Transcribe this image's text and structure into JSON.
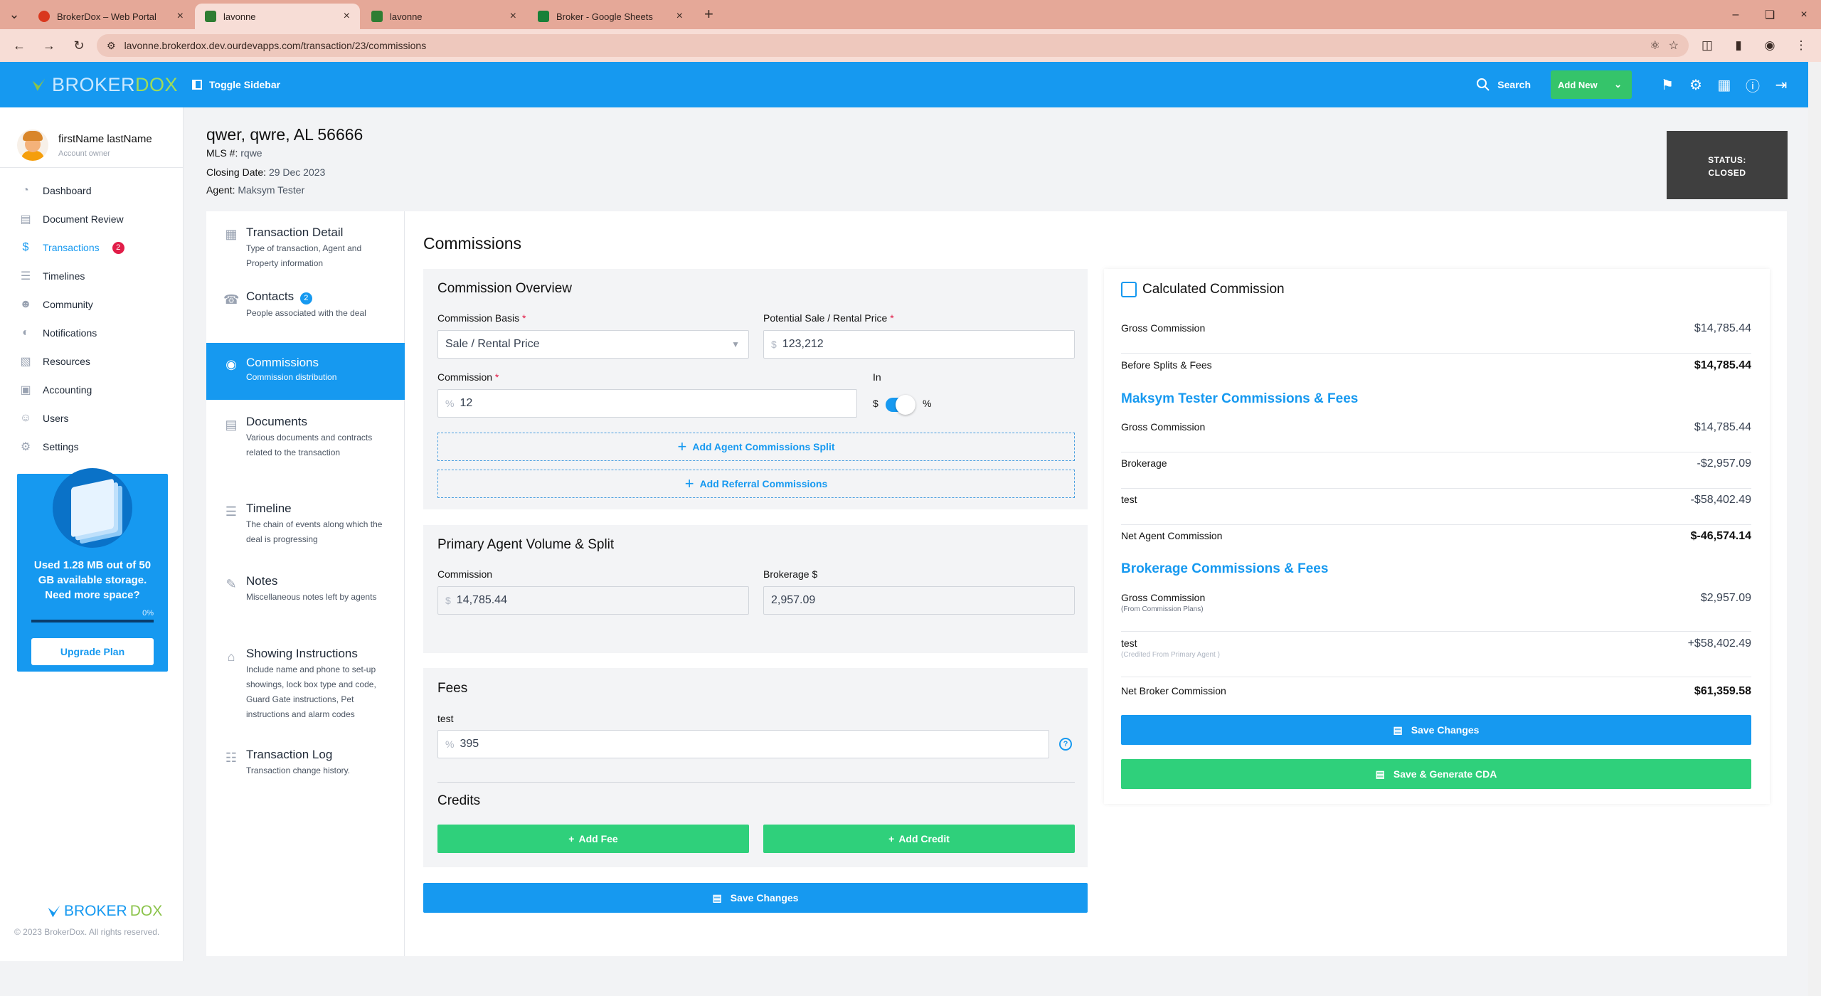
{
  "browser": {
    "tabs": [
      {
        "title": "BrokerDox – Web Portal",
        "favicon_color": "#d9381e"
      },
      {
        "title": "lavonne",
        "favicon_color": "#2e7d32"
      },
      {
        "title": "lavonne",
        "favicon_color": "#2e7d32"
      },
      {
        "title": "Broker - Google Sheets",
        "favicon_color": "#188038"
      }
    ],
    "url": "lavonne.brokerdox.dev.ourdevapps.com/transaction/23/commissions"
  },
  "header": {
    "logo_part1": "BROKER",
    "logo_part2": "DOX",
    "toggle_sidebar": "Toggle Sidebar",
    "search": "Search",
    "add_new": "Add New"
  },
  "sidebar": {
    "user_name": "firstName lastName",
    "user_role": "Account owner",
    "items": [
      {
        "label": "Dashboard",
        "icon": "dashboard-icon"
      },
      {
        "label": "Document Review",
        "icon": "document-icon"
      },
      {
        "label": "Transactions",
        "icon": "dollar-icon",
        "badge": "2"
      },
      {
        "label": "Timelines",
        "icon": "timeline-icon"
      },
      {
        "label": "Community",
        "icon": "community-icon"
      },
      {
        "label": "Notifications",
        "icon": "bell-icon"
      },
      {
        "label": "Resources",
        "icon": "folder-icon"
      },
      {
        "label": "Accounting",
        "icon": "accounting-icon"
      },
      {
        "label": "Users",
        "icon": "user-icon"
      },
      {
        "label": "Settings",
        "icon": "gear-icon"
      }
    ],
    "storage": {
      "line1": "Used ",
      "used": "1.28 MB",
      "line2": " out of ",
      "total": "50 GB",
      "line3": " available storage. Need more space?",
      "percent_label": "0%",
      "used_fraction": 0.0,
      "upgrade": "Upgrade Plan"
    },
    "footer_logo1": "BROKER",
    "footer_logo2": "DOX",
    "copyright": "© 2023 BrokerDox. All rights reserved."
  },
  "transaction": {
    "address": "qwer, qwre, AL 56666",
    "mls_label": "MLS #:",
    "mls": "rqwe",
    "closing_label": "Closing Date:",
    "closing": "29 Dec 2023",
    "agent_label": "Agent:",
    "agent": "Maksym Tester",
    "status_label": "STATUS:",
    "status": "CLOSED"
  },
  "subnav": [
    {
      "title": "Transaction Detail",
      "desc": "Type of transaction, Agent and Property information",
      "icon": "building-icon"
    },
    {
      "title": "Contacts",
      "desc": "People associated with the deal",
      "icon": "phone-icon",
      "badge": "2"
    },
    {
      "title": "Commissions",
      "desc": "Commission distribution",
      "icon": "hand-coin-icon"
    },
    {
      "title": "Documents",
      "desc": "Various documents and contracts related to the transaction",
      "icon": "document-icon"
    },
    {
      "title": "Timeline",
      "desc": "The chain of events along which the deal is progressing",
      "icon": "timeline-icon"
    },
    {
      "title": "Notes",
      "desc": "Miscellaneous notes left by agents",
      "icon": "note-icon"
    },
    {
      "title": "Showing Instructions",
      "desc": "Include name and phone to set-up showings, lock box type and code, Guard Gate instructions, Pet instructions and alarm codes",
      "icon": "house-icon"
    },
    {
      "title": "Transaction Log",
      "desc": "Transaction change history.",
      "icon": "log-icon"
    }
  ],
  "commissions": {
    "title": "Commissions",
    "overview": {
      "title": "Commission Overview",
      "basis_label": "Commission Basis",
      "basis_value": "Sale / Rental Price",
      "price_label": "Potential Sale / Rental Price",
      "price_prefix": "$",
      "price_value": "123,212",
      "commission_label": "Commission",
      "commission_prefix": "%",
      "commission_value": "12",
      "in_label": "In",
      "toggle_left": "$",
      "toggle_right": "%",
      "add_split": "Add Agent Commissions Split",
      "add_referral": "Add Referral Commissions"
    },
    "primary": {
      "title": "Primary Agent Volume & Split",
      "commission_label": "Commission",
      "commission_prefix": "$",
      "commission_value": "14,785.44",
      "brokerage_label": "Brokerage $",
      "brokerage_value": "2,957.09"
    },
    "fees": {
      "title": "Fees",
      "fee_label": "test",
      "fee_prefix": "%",
      "fee_value": "395",
      "credits_title": "Credits",
      "add_fee": "Add Fee",
      "add_credit": "Add Credit"
    },
    "save": "Save Changes"
  },
  "calculated": {
    "title": "Calculated Commission",
    "gross_label": "Gross Commission",
    "gross_value": "$14,785.44",
    "before_label": "Before Splits & Fees",
    "before_value": "$14,785.44",
    "agent_title": "Maksym Tester Commissions & Fees",
    "agent_gross_label": "Gross Commission",
    "agent_gross_value": "$14,785.44",
    "brokerage_label": "Brokerage",
    "brokerage_value": "-$2,957.09",
    "test_label": "test",
    "test_value": "-$58,402.49",
    "net_agent_label": "Net Agent Commission",
    "net_agent_value": "$-46,574.14",
    "brokerage_title": "Brokerage Commissions & Fees",
    "b_gross_label": "Gross Commission",
    "b_gross_sub": "(From Commission Plans)",
    "b_gross_value": "$2,957.09",
    "b_test_label": "test",
    "b_test_sub": "(Credited From Primary Agent )",
    "b_test_value": "+$58,402.49",
    "net_broker_label": "Net Broker Commission",
    "net_broker_value": "$61,359.58",
    "save": "Save Changes",
    "save_cda": "Save & Generate CDA"
  }
}
